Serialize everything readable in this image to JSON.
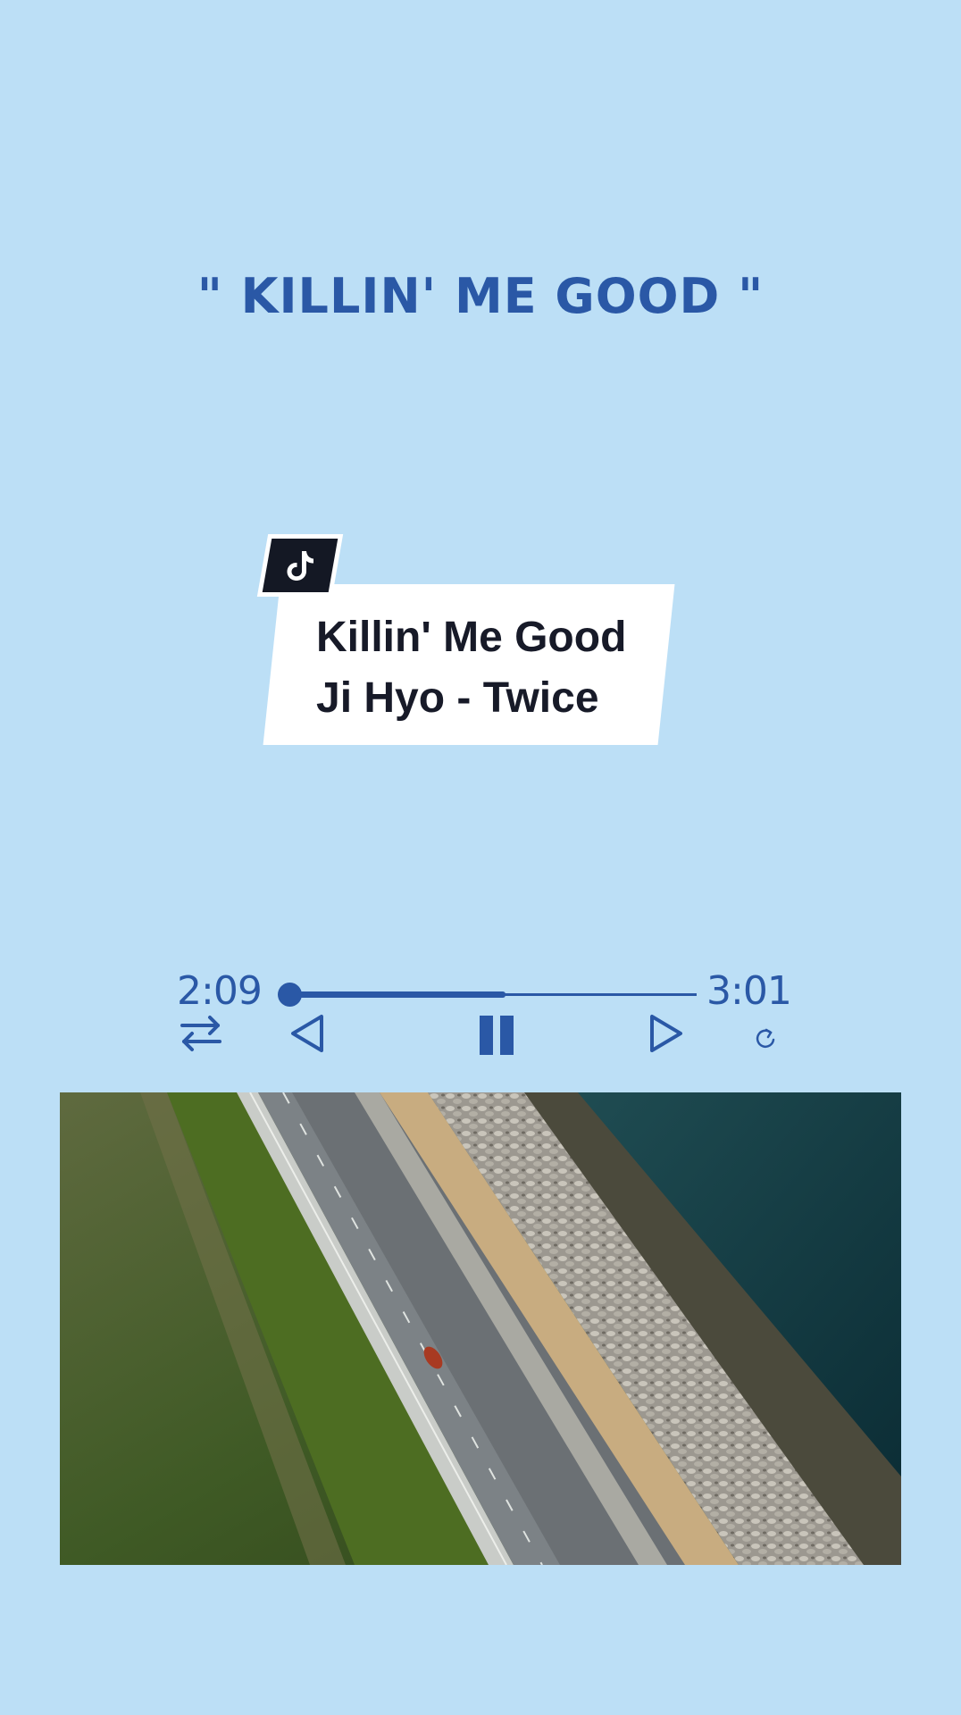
{
  "headline": "\" KILLIN' ME GOOD \"",
  "song_card": {
    "title": "Killin' Me Good",
    "artist_line": "Ji Hyo - Twice",
    "badge_icon": "tiktok-icon"
  },
  "player": {
    "elapsed": "2:09",
    "total": "3:01",
    "progress": 0.0,
    "buffer": 0.53,
    "controls": [
      {
        "name": "repeat-icon"
      },
      {
        "name": "previous-icon"
      },
      {
        "name": "pause-icon"
      },
      {
        "name": "next-icon"
      },
      {
        "name": "replay-icon"
      }
    ]
  },
  "video": {
    "icon": "aerial-road-video"
  },
  "colors": {
    "background": "#bcdff6",
    "accent": "#2a58a6",
    "card": "#ffffff",
    "card_text": "#171a28"
  }
}
